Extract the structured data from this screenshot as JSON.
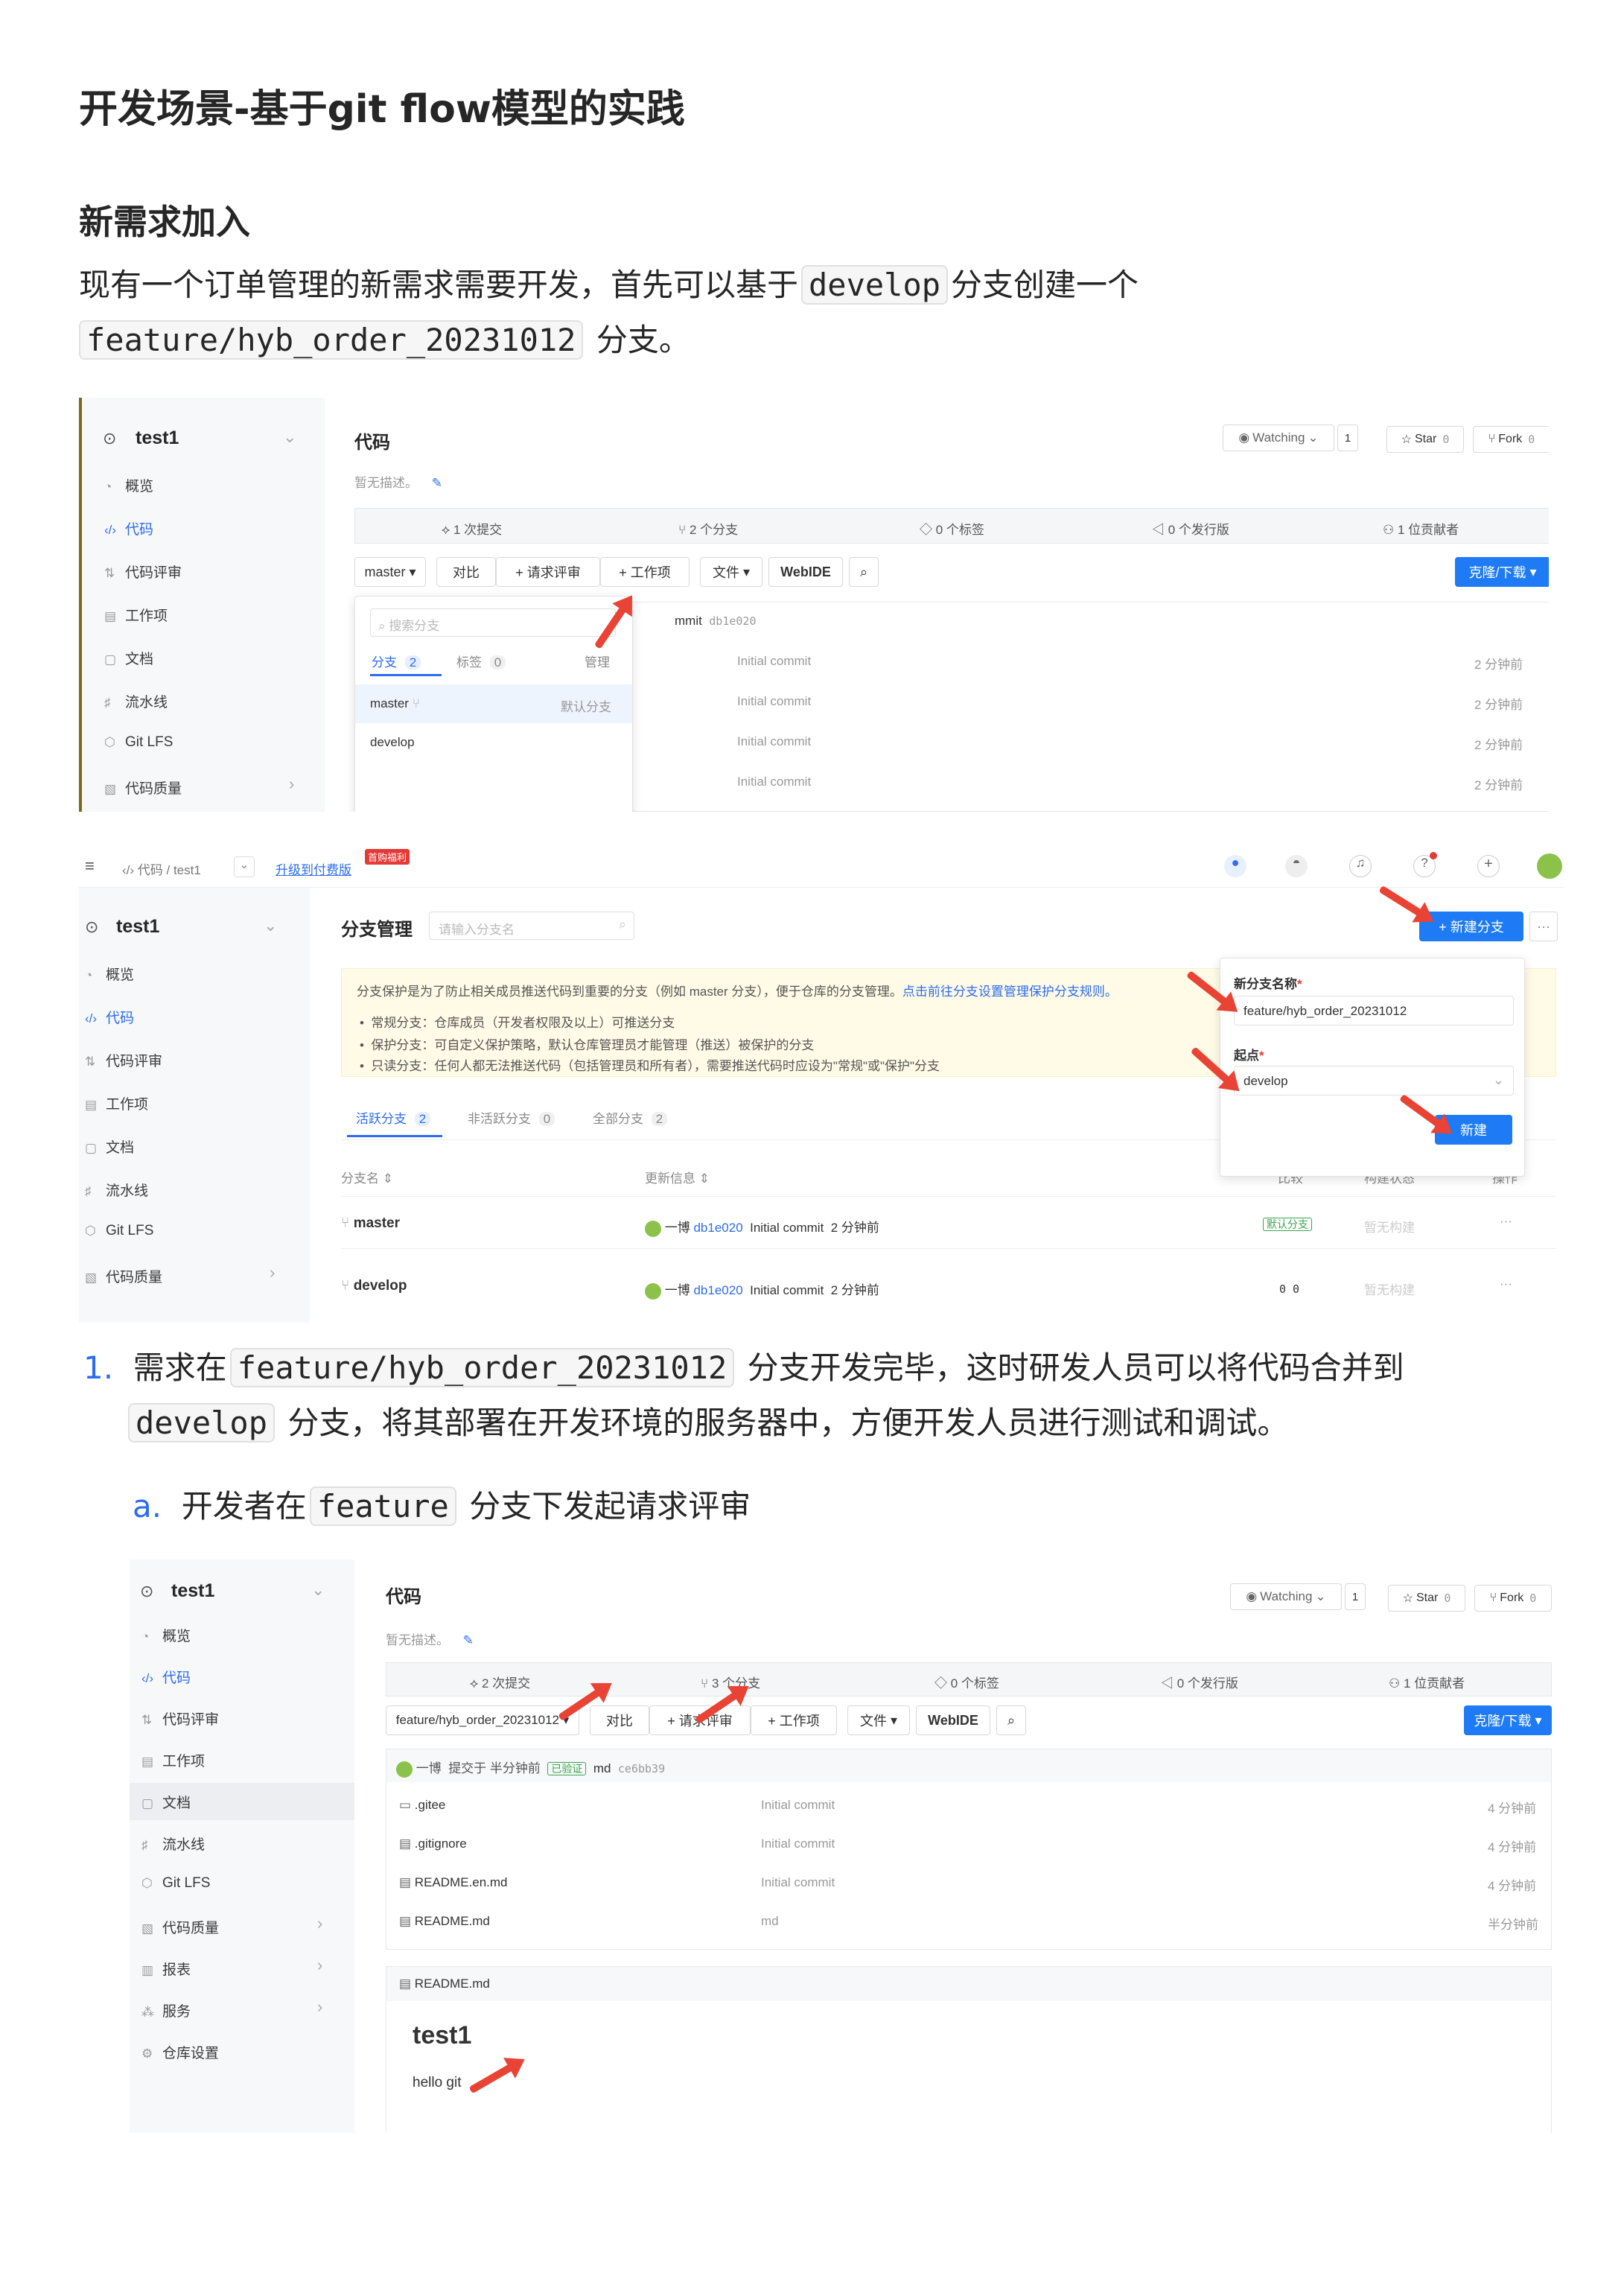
{
  "title": "开发场景-基于git flow模型的实践",
  "section": "新需求加入",
  "intro": {
    "p1": "现有一个订单管理的新需求需要开发，首先可以基于",
    "c1": "develop",
    "p2": "分支创建一个",
    "c2": "feature/hyb_order_20231012",
    "p3": "分支。"
  },
  "step1": {
    "num": "1.",
    "p1": "需求在",
    "c1": "feature/hyb_order_20231012",
    "p2": "分支开发完毕，这时研发人员可以将代码合并到",
    "c2": "develop",
    "p3": "分支，将其部署在开发环境的服务器中，方便开发人员进行测试和调试。"
  },
  "step1a": {
    "num": "a.",
    "p1": "开发者在",
    "c1": "feature",
    "p2": "分支下发起请求评审"
  },
  "sidebar": {
    "repo": "test1",
    "items": [
      "概览",
      "代码",
      "代码评审",
      "工作项",
      "文档",
      "流水线",
      "Git LFS",
      "代码质量",
      "报表",
      "服务",
      "仓库设置"
    ]
  },
  "shot1": {
    "heading": "代码",
    "desc": "暂无描述。",
    "watching": "Watching",
    "watch_count": "1",
    "star": "Star",
    "star_count": "0",
    "fork": "Fork",
    "fork_count": "0",
    "stats": [
      "1 次提交",
      "2 个分支",
      "0 个标签",
      "0 个发行版",
      "1 位贡献者"
    ],
    "branch": "master",
    "buttons": [
      "对比",
      "+ 请求评审",
      "+ 工作项",
      "文件",
      "WebIDE"
    ],
    "clone": "克隆/下载",
    "commit_text": "Initial commit",
    "commit_hash": "db1e020",
    "commit_partial": "mmit",
    "times": [
      "2 分钟前",
      "2 分钟前",
      "2 分钟前",
      "2 分钟前"
    ],
    "dropdown": {
      "search": "搜索分支",
      "tab_branch": "分支",
      "tab_branch_count": "2",
      "tab_tag": "标签",
      "tab_tag_count": "0",
      "manage": "管理",
      "items": [
        "master",
        "develop"
      ],
      "default": "默认分支"
    }
  },
  "shot2": {
    "crumb": [
      "代码",
      "test1"
    ],
    "upgrade": "升级到付费版",
    "promo": "首购福利",
    "heading": "分支管理",
    "search": "请输入分支名",
    "new_branch": "+ 新建分支",
    "notice": "分支保护是为了防止相关成员推送代码到重要的分支（例如 master 分支），便于仓库的分支管理。",
    "notice_link": "点击前往分支设置管理保护分支规则。",
    "bullets": [
      "常规分支：仓库成员（开发者权限及以上）可推送分支",
      "保护分支：可自定义保护策略，默认仓库管理员才能管理（推送）被保护的分支",
      "只读分支：任何人都无法推送代码（包括管理员和所有者），需要推送代码时应设为\"常规\"或\"保护\"分支"
    ],
    "tabs": [
      {
        "label": "活跃分支",
        "count": "2"
      },
      {
        "label": "非活跃分支",
        "count": "0"
      },
      {
        "label": "全部分支",
        "count": "2"
      }
    ],
    "cols": [
      "分支名",
      "更新信息",
      "比较",
      "构建状态",
      "操作"
    ],
    "rows": [
      {
        "name": "master",
        "user": "一博",
        "hash": "db1e020",
        "msg": "Initial commit",
        "time": "2 分钟前",
        "cmp": "默认分支",
        "build": "暂无构建"
      },
      {
        "name": "develop",
        "user": "一博",
        "hash": "db1e020",
        "msg": "Initial commit",
        "time": "2 分钟前",
        "cmp": "0  0",
        "build": "暂无构建"
      }
    ],
    "popup": {
      "name_label": "新分支名称",
      "name_value": "feature/hyb_order_20231012",
      "from_label": "起点",
      "from_value": "develop",
      "create": "新建"
    }
  },
  "shot3": {
    "heading": "代码",
    "desc": "暂无描述。",
    "stats": [
      "2 次提交",
      "3 个分支",
      "0 个标签",
      "0 个发行版",
      "1 位贡献者"
    ],
    "branch": "feature/hyb_order_20231012",
    "commit_user": "一博",
    "commit_info": "提交于 半分钟前",
    "verified": "已验证",
    "commit_msg": "md",
    "commit_hash": "ce6bb39",
    "files": [
      {
        "name": ".gitee",
        "msg": "Initial commit",
        "time": "4 分钟前"
      },
      {
        "name": ".gitignore",
        "msg": "Initial commit",
        "time": "4 分钟前"
      },
      {
        "name": "README.en.md",
        "msg": "Initial commit",
        "time": "4 分钟前"
      },
      {
        "name": "README.md",
        "msg": "md",
        "time": "半分钟前"
      }
    ],
    "readme_label": "README.md",
    "readme_title": "test1",
    "readme_body": "hello git"
  }
}
